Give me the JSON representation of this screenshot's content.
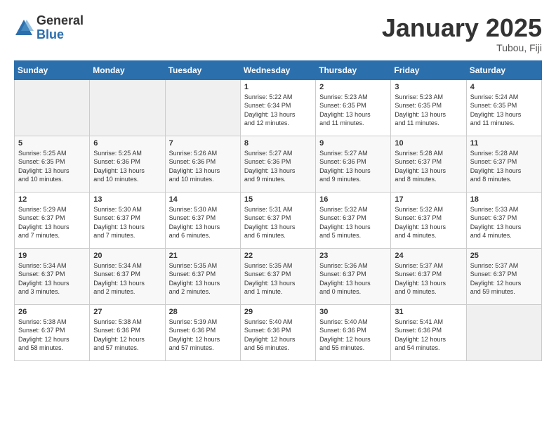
{
  "logo": {
    "general": "General",
    "blue": "Blue"
  },
  "header": {
    "title": "January 2025",
    "subtitle": "Tubou, Fiji"
  },
  "weekdays": [
    "Sunday",
    "Monday",
    "Tuesday",
    "Wednesday",
    "Thursday",
    "Friday",
    "Saturday"
  ],
  "weeks": [
    [
      {
        "day": "",
        "info": ""
      },
      {
        "day": "",
        "info": ""
      },
      {
        "day": "",
        "info": ""
      },
      {
        "day": "1",
        "info": "Sunrise: 5:22 AM\nSunset: 6:34 PM\nDaylight: 13 hours\nand 12 minutes."
      },
      {
        "day": "2",
        "info": "Sunrise: 5:23 AM\nSunset: 6:35 PM\nDaylight: 13 hours\nand 11 minutes."
      },
      {
        "day": "3",
        "info": "Sunrise: 5:23 AM\nSunset: 6:35 PM\nDaylight: 13 hours\nand 11 minutes."
      },
      {
        "day": "4",
        "info": "Sunrise: 5:24 AM\nSunset: 6:35 PM\nDaylight: 13 hours\nand 11 minutes."
      }
    ],
    [
      {
        "day": "5",
        "info": "Sunrise: 5:25 AM\nSunset: 6:35 PM\nDaylight: 13 hours\nand 10 minutes."
      },
      {
        "day": "6",
        "info": "Sunrise: 5:25 AM\nSunset: 6:36 PM\nDaylight: 13 hours\nand 10 minutes."
      },
      {
        "day": "7",
        "info": "Sunrise: 5:26 AM\nSunset: 6:36 PM\nDaylight: 13 hours\nand 10 minutes."
      },
      {
        "day": "8",
        "info": "Sunrise: 5:27 AM\nSunset: 6:36 PM\nDaylight: 13 hours\nand 9 minutes."
      },
      {
        "day": "9",
        "info": "Sunrise: 5:27 AM\nSunset: 6:36 PM\nDaylight: 13 hours\nand 9 minutes."
      },
      {
        "day": "10",
        "info": "Sunrise: 5:28 AM\nSunset: 6:37 PM\nDaylight: 13 hours\nand 8 minutes."
      },
      {
        "day": "11",
        "info": "Sunrise: 5:28 AM\nSunset: 6:37 PM\nDaylight: 13 hours\nand 8 minutes."
      }
    ],
    [
      {
        "day": "12",
        "info": "Sunrise: 5:29 AM\nSunset: 6:37 PM\nDaylight: 13 hours\nand 7 minutes."
      },
      {
        "day": "13",
        "info": "Sunrise: 5:30 AM\nSunset: 6:37 PM\nDaylight: 13 hours\nand 7 minutes."
      },
      {
        "day": "14",
        "info": "Sunrise: 5:30 AM\nSunset: 6:37 PM\nDaylight: 13 hours\nand 6 minutes."
      },
      {
        "day": "15",
        "info": "Sunrise: 5:31 AM\nSunset: 6:37 PM\nDaylight: 13 hours\nand 6 minutes."
      },
      {
        "day": "16",
        "info": "Sunrise: 5:32 AM\nSunset: 6:37 PM\nDaylight: 13 hours\nand 5 minutes."
      },
      {
        "day": "17",
        "info": "Sunrise: 5:32 AM\nSunset: 6:37 PM\nDaylight: 13 hours\nand 4 minutes."
      },
      {
        "day": "18",
        "info": "Sunrise: 5:33 AM\nSunset: 6:37 PM\nDaylight: 13 hours\nand 4 minutes."
      }
    ],
    [
      {
        "day": "19",
        "info": "Sunrise: 5:34 AM\nSunset: 6:37 PM\nDaylight: 13 hours\nand 3 minutes."
      },
      {
        "day": "20",
        "info": "Sunrise: 5:34 AM\nSunset: 6:37 PM\nDaylight: 13 hours\nand 2 minutes."
      },
      {
        "day": "21",
        "info": "Sunrise: 5:35 AM\nSunset: 6:37 PM\nDaylight: 13 hours\nand 2 minutes."
      },
      {
        "day": "22",
        "info": "Sunrise: 5:35 AM\nSunset: 6:37 PM\nDaylight: 13 hours\nand 1 minute."
      },
      {
        "day": "23",
        "info": "Sunrise: 5:36 AM\nSunset: 6:37 PM\nDaylight: 13 hours\nand 0 minutes."
      },
      {
        "day": "24",
        "info": "Sunrise: 5:37 AM\nSunset: 6:37 PM\nDaylight: 13 hours\nand 0 minutes."
      },
      {
        "day": "25",
        "info": "Sunrise: 5:37 AM\nSunset: 6:37 PM\nDaylight: 12 hours\nand 59 minutes."
      }
    ],
    [
      {
        "day": "26",
        "info": "Sunrise: 5:38 AM\nSunset: 6:37 PM\nDaylight: 12 hours\nand 58 minutes."
      },
      {
        "day": "27",
        "info": "Sunrise: 5:38 AM\nSunset: 6:36 PM\nDaylight: 12 hours\nand 57 minutes."
      },
      {
        "day": "28",
        "info": "Sunrise: 5:39 AM\nSunset: 6:36 PM\nDaylight: 12 hours\nand 57 minutes."
      },
      {
        "day": "29",
        "info": "Sunrise: 5:40 AM\nSunset: 6:36 PM\nDaylight: 12 hours\nand 56 minutes."
      },
      {
        "day": "30",
        "info": "Sunrise: 5:40 AM\nSunset: 6:36 PM\nDaylight: 12 hours\nand 55 minutes."
      },
      {
        "day": "31",
        "info": "Sunrise: 5:41 AM\nSunset: 6:36 PM\nDaylight: 12 hours\nand 54 minutes."
      },
      {
        "day": "",
        "info": ""
      }
    ]
  ]
}
